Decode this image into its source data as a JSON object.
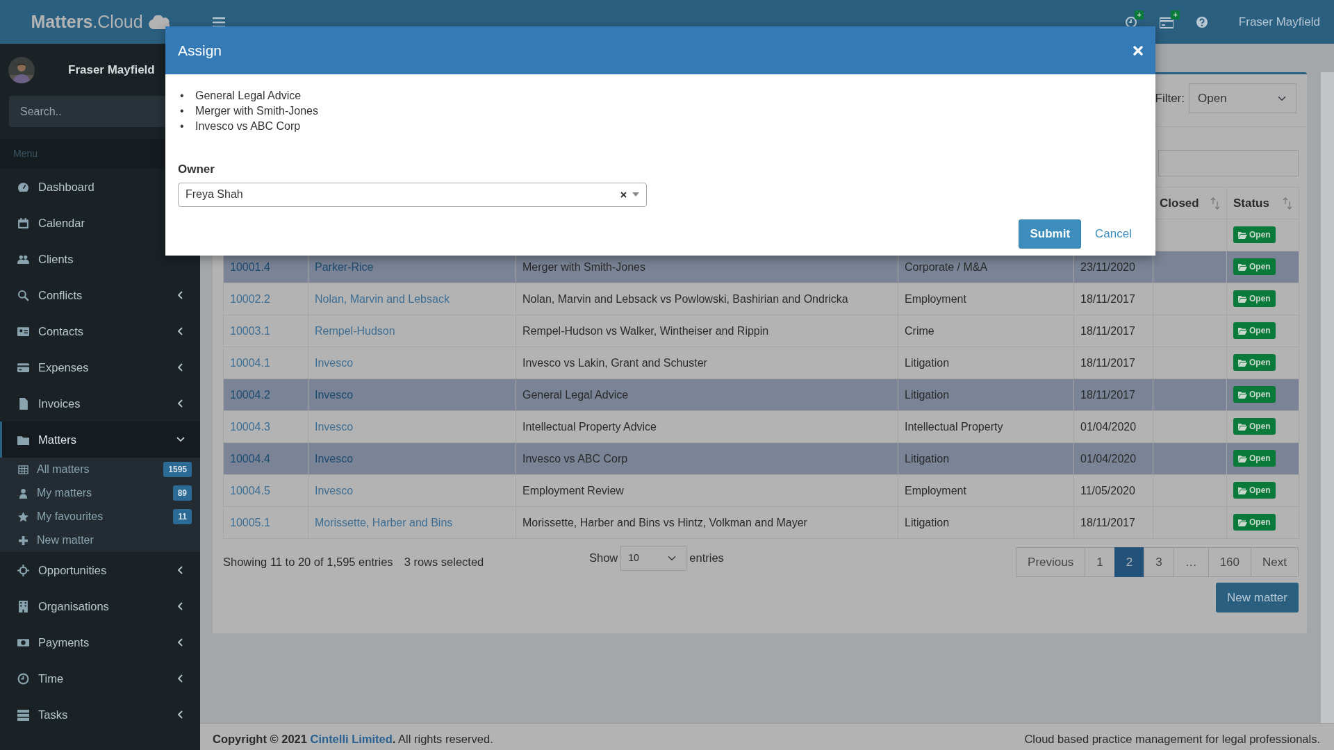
{
  "topbar": {
    "brand": "**Matters**.Cloud",
    "user": "Fraser Mayfield",
    "icons": [
      {
        "kind": "clock",
        "badge": "+"
      },
      {
        "kind": "card",
        "badge": "+"
      },
      {
        "kind": "help"
      }
    ]
  },
  "sidebar": {
    "user": {
      "name": "Fraser Mayfield"
    },
    "search": {
      "placeholder": "Search.."
    },
    "menu_header": "Menu",
    "items": [
      {
        "label": "Dashboard",
        "kind": "link",
        "selected": false
      },
      {
        "label": "Calendar",
        "kind": "link",
        "selected": false
      },
      {
        "label": "Clients",
        "kind": "link",
        "selected": false
      },
      {
        "label": "Conflicts",
        "kind": "tree",
        "expanded": false,
        "selected": false
      },
      {
        "label": "Contacts",
        "kind": "tree",
        "expanded": false,
        "selected": false
      },
      {
        "label": "Expenses",
        "kind": "tree",
        "expanded": false,
        "selected": false
      },
      {
        "label": "Invoices",
        "kind": "tree",
        "expanded": false,
        "selected": false
      },
      {
        "label": "Matters",
        "kind": "tree",
        "expanded": true,
        "selected": true,
        "children": [
          {
            "label": "All matters",
            "count": "1595"
          },
          {
            "label": "My matters",
            "count": "89"
          },
          {
            "label": "My favourites",
            "count": "11"
          },
          {
            "label": "New matter"
          }
        ]
      },
      {
        "label": "Opportunities",
        "kind": "tree",
        "expanded": false,
        "selected": false
      },
      {
        "label": "Organisations",
        "kind": "tree",
        "expanded": false,
        "selected": false
      },
      {
        "label": "Payments",
        "kind": "tree",
        "expanded": false,
        "selected": false
      },
      {
        "label": "Time",
        "kind": "tree",
        "expanded": false,
        "selected": false
      },
      {
        "label": "Tasks",
        "kind": "tree",
        "expanded": false,
        "selected": false
      }
    ]
  },
  "content": {
    "filter": {
      "label": "Filter:",
      "value": "Open"
    },
    "table": {
      "headers": [
        {
          "label": "Closed"
        },
        {
          "label": "Status"
        }
      ],
      "rows": [
        {
          "selected": false,
          "status": "Open"
        },
        {
          "column_1": "10001.4",
          "column_2": "Parker-Rice",
          "column_3": "Merger with Smith-Jones",
          "column_4": "Corporate / M&A",
          "column_5": "23/11/2020",
          "status": "Open",
          "selected": true
        },
        {
          "column_1": "10002.2",
          "column_2": "Nolan, Marvin and Lebsack",
          "column_3": "Nolan, Marvin and Lebsack vs Powlowski, Bashirian and Ondricka",
          "column_4": "Employment",
          "column_5": "18/11/2017",
          "status": "Open",
          "selected": false
        },
        {
          "column_1": "10003.1",
          "column_2": "Rempel-Hudson",
          "column_3": "Rempel-Hudson vs Walker, Wintheiser and Rippin",
          "column_4": "Crime",
          "column_5": "18/11/2017",
          "status": "Open",
          "selected": false
        },
        {
          "column_1": "10004.1",
          "column_2": "Invesco",
          "column_3": "Invesco vs Lakin, Grant and Schuster",
          "column_4": "Litigation",
          "column_5": "18/11/2017",
          "status": "Open",
          "selected": false
        },
        {
          "column_1": "10004.2",
          "column_2": "Invesco",
          "column_3": "General Legal Advice",
          "column_4": "Litigation",
          "column_5": "18/11/2017",
          "status": "Open",
          "selected": true
        },
        {
          "column_1": "10004.3",
          "column_2": "Invesco",
          "column_3": "Intellectual Property Advice",
          "column_4": "Intellectual Property",
          "column_5": "01/04/2020",
          "status": "Open",
          "selected": false
        },
        {
          "column_1": "10004.4",
          "column_2": "Invesco",
          "column_3": "Invesco vs ABC Corp",
          "column_4": "Litigation",
          "column_5": "01/04/2020",
          "status": "Open",
          "selected": true
        },
        {
          "column_1": "10004.5",
          "column_2": "Invesco",
          "column_3": "Employment Review",
          "column_4": "Employment",
          "column_5": "11/05/2020",
          "status": "Open",
          "selected": false
        },
        {
          "column_1": "10005.1",
          "column_2": "Morissette, Harber and Bins",
          "column_3": "Morissette, Harber and Bins vs Hintz, Volkman and Mayer",
          "column_4": "Litigation",
          "column_5": "18/11/2017",
          "status": "Open",
          "selected": false
        }
      ]
    },
    "info": "Showing 11 to 20 of 1,595 entries",
    "selection": "3 rows selected",
    "length": {
      "before": "Show",
      "value": "10",
      "after": "entries"
    },
    "pagination": [
      {
        "label": "Previous",
        "selected": false
      },
      {
        "label": "1",
        "selected": false
      },
      {
        "label": "2",
        "selected": true
      },
      {
        "label": "3",
        "selected": false
      },
      {
        "label": "…",
        "selected": false
      },
      {
        "label": "160",
        "selected": false
      },
      {
        "label": "Next",
        "selected": false
      }
    ],
    "new_button": "New matter"
  },
  "footer": {
    "copyright": "**Copyright © 2021**",
    "company": "Cintelli Limited",
    "rights": "**.** All rights reserved.",
    "tagline": "Cloud based practice management for legal professionals."
  },
  "modal": {
    "title": "Assign",
    "items": [
      {
        "bullet": "•",
        "text": "General Legal Advice"
      },
      {
        "bullet": "•",
        "text": "Merger with Smith-Jones"
      },
      {
        "bullet": "•",
        "text": "Invesco vs ABC Corp"
      }
    ],
    "owner": {
      "label": "Owner",
      "value": "Freya Shah"
    },
    "buttons": [
      {
        "label": "Submit",
        "kind": "primary"
      },
      {
        "label": "Cancel",
        "kind": "link"
      }
    ]
  }
}
